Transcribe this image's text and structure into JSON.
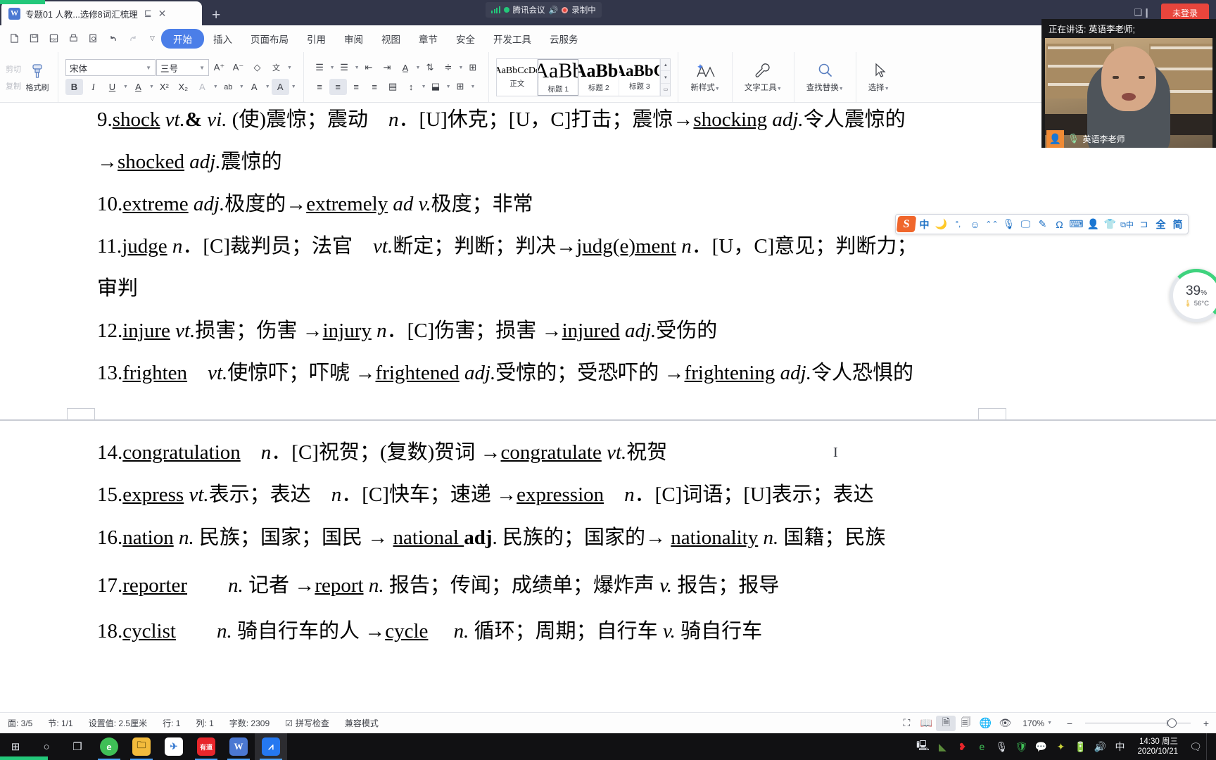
{
  "window": {
    "tab_title": "专题01 人教...选修8词汇梳理",
    "tab_word_icon": "W",
    "restore_icon": "⊑",
    "close_icon": "✕",
    "new_tab_icon": "+",
    "minimize_icon": "❑❙",
    "login_label": "未登录"
  },
  "meeting_pill": {
    "app_name": "腾讯会议",
    "recording_label": "录制中",
    "signal_icon": "signal-bars-icon",
    "speaker_icon": "speaker-icon",
    "record_icon": "record-dot-icon"
  },
  "video_panel": {
    "speaking_label": "正在讲话: 英语李老师;",
    "participant_name": "英语李老师",
    "avatar_icon": "person-icon",
    "mic_icon": "microphone-icon"
  },
  "quick_access": [
    {
      "name": "new-document",
      "icon": "🗋"
    },
    {
      "name": "save",
      "icon": "🖫"
    },
    {
      "name": "export-pdf",
      "icon": "PDF"
    },
    {
      "name": "print",
      "icon": "🖶"
    },
    {
      "name": "print-preview",
      "icon": "🔍"
    },
    {
      "name": "undo",
      "icon": "↰"
    },
    {
      "name": "redo",
      "icon": "↱"
    },
    {
      "name": "customize",
      "icon": "▾"
    }
  ],
  "ribbon_tabs": [
    {
      "label": "开始",
      "active": true
    },
    {
      "label": "插入",
      "active": false
    },
    {
      "label": "页面布局",
      "active": false
    },
    {
      "label": "引用",
      "active": false
    },
    {
      "label": "审阅",
      "active": false
    },
    {
      "label": "视图",
      "active": false
    },
    {
      "label": "章节",
      "active": false
    },
    {
      "label": "安全",
      "active": false
    },
    {
      "label": "开发工具",
      "active": false
    },
    {
      "label": "云服务",
      "active": false
    }
  ],
  "clipboard_group": {
    "cut_label": "剪切",
    "copy_label": "复制",
    "format_painter_label": "格式刷",
    "format_painter_icon": "paint-brush-icon"
  },
  "font_group": {
    "font_family_value": "宋体",
    "font_size_value": "三号",
    "grow_font_icon": "A⁺",
    "shrink_font_icon": "A⁻",
    "clear_format_icon": "eraser-icon",
    "pinyin_icon": "wén-guide-icon",
    "bold_icon": "B",
    "italic_icon": "I",
    "underline_icon": "U",
    "strikethrough_icon": "A",
    "superscript_icon": "X²",
    "subscript_icon": "X₂",
    "char_border_icon": "A",
    "char_shading_icon": "ab",
    "text_effects_icon": "A",
    "highlight_icon": "A",
    "font_color_icon": "A"
  },
  "paragraph_group": {
    "bullets_icon": "list-bullets-icon",
    "numbering_icon": "list-numbered-icon",
    "decrease_indent_icon": "outdent-icon",
    "increase_indent_icon": "indent-icon",
    "line_spacing_icon": "line-spacing-icon",
    "sort_icon": "sort-icon",
    "show_marks_icon": "paragraph-marks-icon",
    "table_icon": "table-icon",
    "align_left_icon": "align-left-icon",
    "align_center_icon": "align-center-icon",
    "align_right_icon": "align-right-icon",
    "align_justify_icon": "align-justify-icon",
    "distribute_icon": "distribute-icon",
    "borders_icon": "borders-icon",
    "shading_icon": "shading-icon"
  },
  "styles_gallery": {
    "items": [
      {
        "preview": "AaBbCcDc",
        "label": "正文",
        "size": 14,
        "weight": "normal",
        "selected": false
      },
      {
        "preview": "AaBb",
        "label": "标题 1",
        "size": 31,
        "weight": "normal",
        "selected": true
      },
      {
        "preview": "AaBb(",
        "label": "标题 2",
        "size": 27,
        "weight": "bold",
        "selected": false
      },
      {
        "preview": "AaBbC",
        "label": "标题 3",
        "size": 23,
        "weight": "bold",
        "selected": false
      }
    ],
    "scroll_up_icon": "▴",
    "scroll_down_icon": "▾",
    "more_icon": "▭"
  },
  "ribbon_buttons": [
    {
      "label": "新样式",
      "icon": "new-style-icon",
      "dropdown": true
    },
    {
      "label": "文字工具",
      "icon": "wrench-icon",
      "dropdown": true
    },
    {
      "label": "查找替换",
      "icon": "magnifier-icon",
      "dropdown": true
    },
    {
      "label": "选择",
      "icon": "cursor-arrow-icon",
      "dropdown": true
    }
  ],
  "document": {
    "lines": [
      {
        "html": "9.<u>shock</u> <i>vt.</i><b>&amp;</b> <i>vi.</i> (使)震惊；震动　<i>n</i>．[U]休克；[U，C]打击；震惊→<u>shocking</u> <i>adj.</i>令人震惊的"
      },
      {
        "html": "→<u>shocked</u> <i>adj.</i>震惊的"
      },
      {
        "html": "10.<u>extreme</u> <i>adj.</i>极度的→<u>extremely</u> <i>ad v.</i>极度；非常"
      },
      {
        "html": "11.<u>judge</u> <i>n</i>．[C]裁判员；法官　<i>vt.</i>断定；判断；判决→<u>judg(e)ment</u> <i>n</i>．[U，C]意见；判断力；"
      },
      {
        "html": "审判"
      },
      {
        "html": "12.<u>injure</u> <i>vt.</i>损害；伤害 →<u>injury</u> <i>n</i>．[C]伤害；损害 →<u>injured</u> <i>adj.</i>受伤的"
      },
      {
        "html": "13.<u>frighten</u>　<i>vt.</i>使惊吓；吓唬 →<u>frightened</u> <i>adj.</i>受惊的；受恐吓的 →<u>frightening</u> <i>adj.</i>令人恐惧的"
      },
      {
        "html": "14.<u>congratulation</u>　<i>n</i>．[C]祝贺；(复数)贺词 →<u>congratulate</u> <i>vt.</i>祝贺"
      },
      {
        "html": "15.<u>express</u> <i>vt.</i>表示；表达　<i>n</i>．[C]快车；速递 →<u>expression</u>　<i>n</i>．[C]词语；[U]表示；表达"
      },
      {
        "html": "16.<u>nation</u> <i>n.</i> 民族；国家；国民 → <u>national </u><b>adj</b>. 民族的；国家的→ <u> nationality</u> <i>n.</i> 国籍；民族"
      },
      {
        "html": "17.<u>reporter</u>　　<i>n.</i>  记者 →<u>report</u> <i>n.</i> 报告；传闻；成绩单；爆炸声 <i>v.</i> 报告；报导"
      },
      {
        "html": "18.<u>cyclist</u>　　<i>n.</i>  骑自行车的人 →<u>cycle</u>　 <i>n.</i>  循环；周期；自行车 <i>v.</i> 骑自行车"
      }
    ]
  },
  "sogou_ime": {
    "logo": "S",
    "items": [
      {
        "name": "chinese-mode-icon",
        "glyph": "中"
      },
      {
        "name": "moon-icon",
        "glyph": "🌙"
      },
      {
        "name": "punctuation-icon",
        "glyph": "°,"
      },
      {
        "name": "emoji-icon",
        "glyph": "☺"
      },
      {
        "name": "expression-icon",
        "glyph": "⌃⌃"
      },
      {
        "name": "voice-input-icon",
        "glyph": "🎤"
      },
      {
        "name": "screenshot-icon",
        "glyph": "🖵"
      },
      {
        "name": "handwriting-icon",
        "glyph": "✎"
      },
      {
        "name": "symbol-icon",
        "glyph": "Ω"
      },
      {
        "name": "soft-keyboard-icon",
        "glyph": "⌨"
      },
      {
        "name": "user-center-icon",
        "glyph": "👤"
      },
      {
        "name": "skin-icon",
        "glyph": "👕"
      },
      {
        "name": "translate-icon",
        "glyph": "🔤"
      },
      {
        "name": "crop-icon",
        "glyph": "⊐"
      },
      {
        "name": "full-width-icon",
        "glyph": "全"
      },
      {
        "name": "simplified-icon",
        "glyph": "简"
      }
    ]
  },
  "cpu_widget": {
    "percent": "39",
    "percent_unit": "%",
    "temperature": "56°C",
    "thermometer_icon": "thermometer-icon"
  },
  "status_bar": {
    "page_label": "面: 3/5",
    "section_label": "节: 1/1",
    "setting_label": "设置值: 2.5厘米",
    "row_label": "行: 1",
    "col_label": "列: 1",
    "word_count_label": "字数: 2309",
    "spellcheck_label": "拼写检查",
    "compat_label": "兼容模式",
    "view_buttons": [
      {
        "name": "fullscreen-view-icon",
        "glyph": "⛶",
        "active": false
      },
      {
        "name": "two-page-view-icon",
        "glyph": "▥",
        "active": false
      },
      {
        "name": "page-view-icon",
        "glyph": "▤",
        "active": true
      },
      {
        "name": "outline-view-icon",
        "glyph": "▤",
        "active": false
      },
      {
        "name": "web-view-icon",
        "glyph": "⊕",
        "active": false
      },
      {
        "name": "eye-protection-icon",
        "glyph": "◉",
        "active": false
      }
    ],
    "zoom_value": "170%",
    "zoom_minus": "−",
    "zoom_plus": "+"
  },
  "taskbar": {
    "start_icon": "windows-start-icon",
    "search_icon": "search-icon",
    "taskview_icon": "task-view-icon",
    "apps": [
      {
        "name": "360-browser",
        "glyph": "e",
        "color": "#3fbf56",
        "running": true,
        "focused": false
      },
      {
        "name": "file-explorer",
        "glyph": "🗀",
        "color": "#f3bb3c",
        "running": true,
        "focused": false
      },
      {
        "name": "foxmail",
        "glyph": "✈",
        "color": "#ffffff",
        "running": false,
        "focused": false
      },
      {
        "name": "youdao-dictionary",
        "glyph": "有道",
        "color": "#e8262b",
        "running": true,
        "focused": false
      },
      {
        "name": "wps-writer",
        "glyph": "W",
        "color": "#4b78d2",
        "running": true,
        "focused": false
      },
      {
        "name": "tencent-meeting",
        "glyph": "⩘",
        "color": "#2578f0",
        "running": true,
        "focused": true
      }
    ],
    "tray": [
      {
        "name": "remote-desktop-icon",
        "glyph": "🖳"
      },
      {
        "name": "nvidia-icon",
        "glyph": "◢"
      },
      {
        "name": "red-app-icon",
        "glyph": "❥"
      },
      {
        "name": "360-tray-icon",
        "glyph": "e"
      },
      {
        "name": "microphone-tray-icon",
        "glyph": "🎤"
      },
      {
        "name": "security-shield-icon",
        "glyph": "🛡"
      },
      {
        "name": "wechat-icon",
        "glyph": "💬"
      },
      {
        "name": "accelerator-icon",
        "glyph": "✦"
      },
      {
        "name": "battery-icon",
        "glyph": "🔋"
      },
      {
        "name": "volume-icon",
        "glyph": "🔊"
      },
      {
        "name": "ime-indicator",
        "glyph": "中"
      }
    ],
    "clock_time": "14:30 周三",
    "clock_date": "2020/10/21",
    "notification_icon": "notification-icon"
  }
}
